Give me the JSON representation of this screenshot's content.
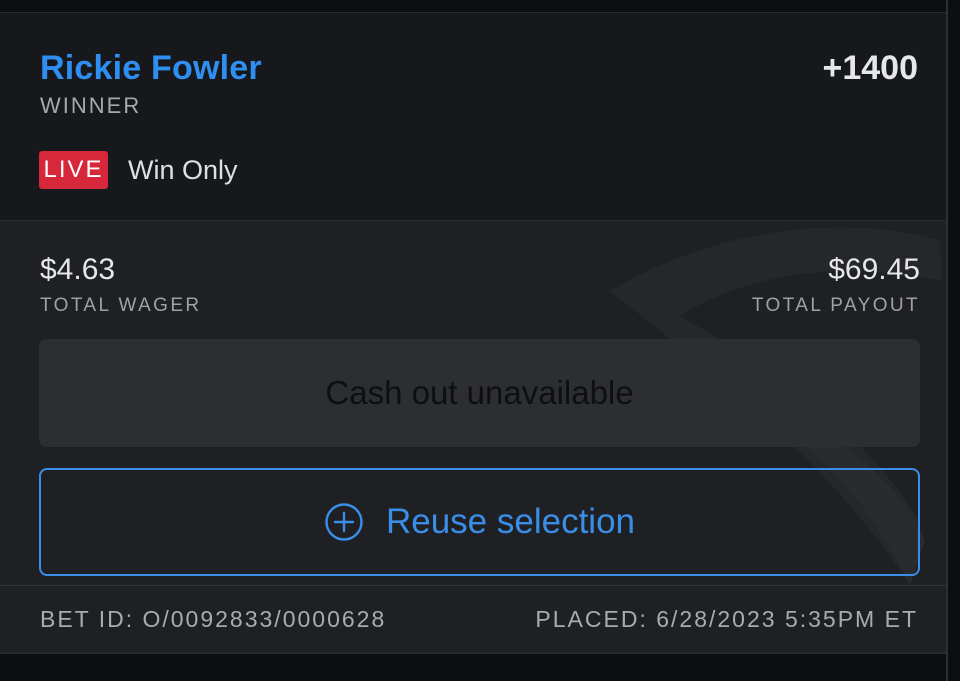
{
  "bet": {
    "selection": "Rickie Fowler",
    "odds": "+1400",
    "market": "WINNER",
    "live_badge": "LIVE",
    "bet_type": "Win Only"
  },
  "totals": {
    "wager_amount": "$4.63",
    "wager_label": "TOTAL WAGER",
    "payout_amount": "$69.45",
    "payout_label": "TOTAL PAYOUT"
  },
  "actions": {
    "cashout_label": "Cash out unavailable",
    "reuse_label": "Reuse selection",
    "reuse_icon": "plus-circle-icon"
  },
  "footer": {
    "bet_id": "BET ID: O/0092833/0000628",
    "placed": "PLACED: 6/28/2023 5:35PM ET"
  },
  "colors": {
    "accent_blue": "#2f8ff0",
    "live_red": "#d6283a",
    "card_bg": "#17181c",
    "panel_bg": "#1f2024"
  }
}
